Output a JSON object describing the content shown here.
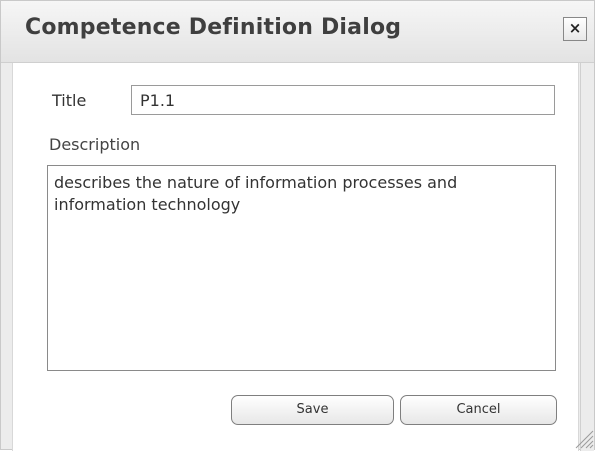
{
  "dialog": {
    "title": "Competence Definition Dialog",
    "close_symbol": "×",
    "close_icon": "close-icon"
  },
  "form": {
    "title_label": "Title",
    "title_value": "P1.1",
    "description_label": "Description",
    "description_value": "describes the nature of information processes and information technology"
  },
  "buttons": {
    "save_label": "Save",
    "cancel_label": "Cancel"
  },
  "colors": {
    "titlebar": "#e9e9e9",
    "body": "#ffffff",
    "border": "#8a8a8a"
  }
}
